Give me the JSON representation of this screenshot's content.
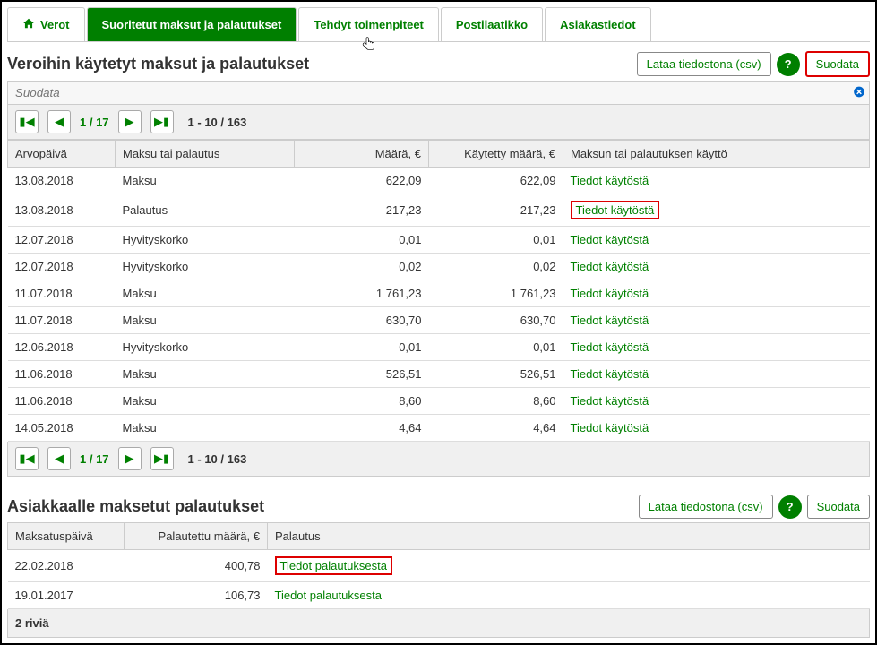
{
  "tabs": {
    "verot": "Verot",
    "suoritetut": "Suoritetut maksut ja palautukset",
    "tehdyt": "Tehdyt toimenpiteet",
    "postilaatikko": "Postilaatikko",
    "asiakastiedot": "Asiakastiedot"
  },
  "section1": {
    "title": "Veroihin käytetyt maksut ja palautukset",
    "csv_btn": "Lataa tiedostona (csv)",
    "filter_btn": "Suodata",
    "filter_placeholder": "Suodata",
    "pager_page": "1 / 17",
    "pager_count": "1 - 10 / 163",
    "headers": {
      "arvopaiva": "Arvopäivä",
      "maksu": "Maksu tai palautus",
      "maara": "Määrä, €",
      "kaytetty": "Käytetty määrä, €",
      "kaytto": "Maksun tai palautuksen käyttö"
    },
    "rows": [
      {
        "date": "13.08.2018",
        "type": "Maksu",
        "amount": "622,09",
        "used": "622,09",
        "link": "Tiedot käytöstä",
        "hl": false
      },
      {
        "date": "13.08.2018",
        "type": "Palautus",
        "amount": "217,23",
        "used": "217,23",
        "link": "Tiedot käytöstä",
        "hl": true
      },
      {
        "date": "12.07.2018",
        "type": "Hyvityskorko",
        "amount": "0,01",
        "used": "0,01",
        "link": "Tiedot käytöstä",
        "hl": false
      },
      {
        "date": "12.07.2018",
        "type": "Hyvityskorko",
        "amount": "0,02",
        "used": "0,02",
        "link": "Tiedot käytöstä",
        "hl": false
      },
      {
        "date": "11.07.2018",
        "type": "Maksu",
        "amount": "1 761,23",
        "used": "1 761,23",
        "link": "Tiedot käytöstä",
        "hl": false
      },
      {
        "date": "11.07.2018",
        "type": "Maksu",
        "amount": "630,70",
        "used": "630,70",
        "link": "Tiedot käytöstä",
        "hl": false
      },
      {
        "date": "12.06.2018",
        "type": "Hyvityskorko",
        "amount": "0,01",
        "used": "0,01",
        "link": "Tiedot käytöstä",
        "hl": false
      },
      {
        "date": "11.06.2018",
        "type": "Maksu",
        "amount": "526,51",
        "used": "526,51",
        "link": "Tiedot käytöstä",
        "hl": false
      },
      {
        "date": "11.06.2018",
        "type": "Maksu",
        "amount": "8,60",
        "used": "8,60",
        "link": "Tiedot käytöstä",
        "hl": false
      },
      {
        "date": "14.05.2018",
        "type": "Maksu",
        "amount": "4,64",
        "used": "4,64",
        "link": "Tiedot käytöstä",
        "hl": false
      }
    ]
  },
  "section2": {
    "title": "Asiakkaalle maksetut palautukset",
    "csv_btn": "Lataa tiedostona (csv)",
    "filter_btn": "Suodata",
    "headers": {
      "maksatuspaiva": "Maksatuspäivä",
      "palautettu": "Palautettu määrä, €",
      "palautus": "Palautus"
    },
    "rows": [
      {
        "date": "22.02.2018",
        "amount": "400,78",
        "link": "Tiedot palautuksesta",
        "hl": true
      },
      {
        "date": "19.01.2017",
        "amount": "106,73",
        "link": "Tiedot palautuksesta",
        "hl": false
      }
    ],
    "footer": "2 riviä"
  }
}
